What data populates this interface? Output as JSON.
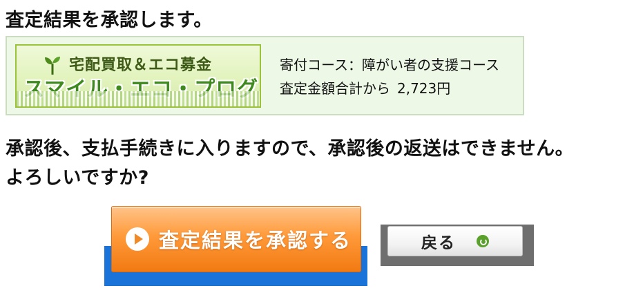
{
  "heading": "査定結果を承認します。",
  "banner": {
    "top_text": "宅配買取＆エコ募金",
    "main_text": "スマイル・エコ・プログラム"
  },
  "donation": {
    "course": "寄付コース：障がい者の支援コース",
    "total_label": "査定金額合計から",
    "total_amount": "2,723円"
  },
  "message": {
    "line1": "承認後、支払手続きに入りますので、承認後の返送はできません。",
    "line2": "よろしいですか?"
  },
  "buttons": {
    "approve_label": "査定結果を承認する",
    "back_label": "戻る"
  },
  "icons": {
    "approve": "play-circle-icon",
    "back": "return-icon",
    "sprout": "sprout-icon"
  },
  "colors": {
    "approve_button": "#f28a26",
    "focus_outline": "#1a73d9",
    "info_box": "#edf8e6",
    "brand_green": "#3f8a1e"
  }
}
